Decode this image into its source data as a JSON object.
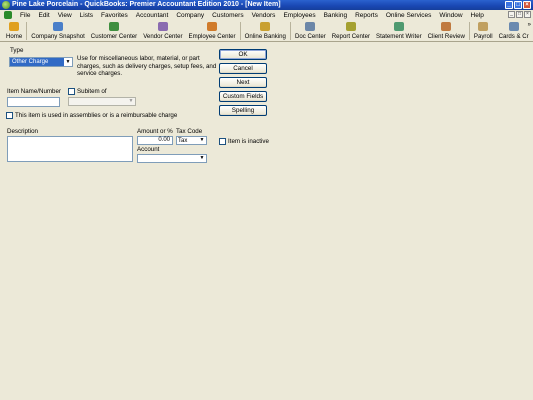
{
  "window": {
    "title": "Pine Lake Porcelain  -  QuickBooks: Premier Accountant Edition 2010 - [New Item]"
  },
  "menu": [
    "File",
    "Edit",
    "View",
    "Lists",
    "Favorites",
    "Accountant",
    "Company",
    "Customers",
    "Vendors",
    "Employees",
    "Banking",
    "Reports",
    "Online Services",
    "Window",
    "Help"
  ],
  "toolbar": [
    {
      "label": "Home",
      "icon": "home-icon",
      "color": "#e0a020"
    },
    {
      "label": "Company Snapshot",
      "icon": "snapshot-icon",
      "color": "#4a7fc9"
    },
    {
      "label": "Customer Center",
      "icon": "customers-icon",
      "color": "#3f8f3f"
    },
    {
      "label": "Vendor Center",
      "icon": "vendors-icon",
      "color": "#8a6bb0"
    },
    {
      "label": "Employee Center",
      "icon": "employees-icon",
      "color": "#d07b2b"
    },
    {
      "label": "Online Banking",
      "icon": "banking-icon",
      "color": "#c9a030"
    },
    {
      "label": "Doc Center",
      "icon": "docs-icon",
      "color": "#6c87a8"
    },
    {
      "label": "Report Center",
      "icon": "reports-icon",
      "color": "#a4a030"
    },
    {
      "label": "Statement Writer",
      "icon": "statement-icon",
      "color": "#4f9a70"
    },
    {
      "label": "Client Review",
      "icon": "review-icon",
      "color": "#c07a40"
    },
    {
      "label": "Payroll",
      "icon": "payroll-icon",
      "color": "#c0a060"
    },
    {
      "label": "Cards & Cr",
      "icon": "cards-icon",
      "color": "#6a8ab0"
    }
  ],
  "form": {
    "type_label": "Type",
    "type_value": "Other Charge",
    "type_description": "Use for miscellaneous labor, material, or part charges, such as delivery charges, setup fees, and service charges.",
    "item_name_label": "Item Name/Number",
    "item_name_value": "",
    "subitem_label": "Subitem of",
    "subitem_value": "",
    "assembly_label": "This item is used in assemblies or is a reimbursable charge",
    "description_label": "Description",
    "description_value": "",
    "amount_label": "Amount or %",
    "amount_value": "0.00",
    "tax_code_label": "Tax Code",
    "tax_code_value": "Tax",
    "account_label": "Account",
    "account_value": "",
    "inactive_label": "Item is inactive"
  },
  "buttons": {
    "ok": "OK",
    "cancel": "Cancel",
    "next": "Next",
    "custom_fields": "Custom Fields",
    "spelling": "Spelling"
  },
  "colors": {
    "titlebar": "#1947b3",
    "selection": "#316ac5",
    "background": "#ece9d8"
  }
}
